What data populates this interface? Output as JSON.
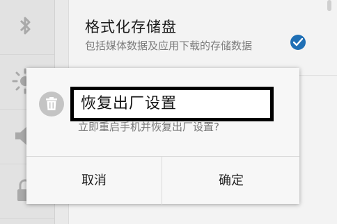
{
  "settings": {
    "format_title": "格式化存储盘",
    "format_desc": "包括媒体数据及应用下载的存储数据",
    "format_checked": true,
    "sidebar_icons": [
      "bluetooth-icon",
      "brightness-icon",
      "volume-icon",
      "lock-icon"
    ]
  },
  "dialog": {
    "icon": "trash-icon",
    "title": "恢复出厂设置",
    "message": "立即重启手机并恢复出厂设置?",
    "cancel_label": "取消",
    "ok_label": "确定"
  },
  "colors": {
    "accent": "#1f6fb5",
    "dialog_bg": "#f7f7f7",
    "title_border": "#000000"
  }
}
